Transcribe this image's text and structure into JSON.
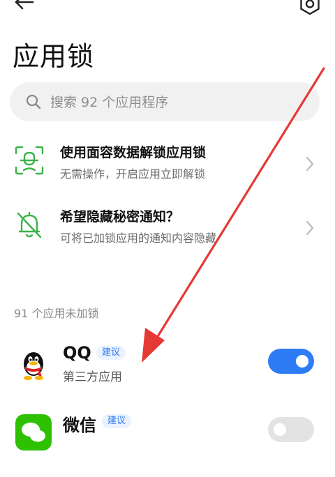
{
  "page": {
    "title": "应用锁"
  },
  "search": {
    "placeholder": "搜索 92 个应用程序"
  },
  "features": [
    {
      "title": "使用面容数据解锁应用锁",
      "description": "无需操作，开启应用立即解锁",
      "icon": "face-scan-icon"
    },
    {
      "title": "希望隐藏秘密通知？",
      "description": "可将已加锁应用的通知内容隐藏",
      "icon": "bell-off-icon"
    }
  ],
  "section": {
    "label": "91 个应用未加锁"
  },
  "apps": [
    {
      "name": "QQ",
      "badge": "建议",
      "subtitle": "第三方应用",
      "toggle_on": true
    },
    {
      "name": "微信",
      "badge": "建议",
      "subtitle": "",
      "toggle_on": false
    }
  ],
  "colors": {
    "accent": "#2e7bf6",
    "green_icon": "#3bb24a",
    "annotation_arrow": "#e53935"
  }
}
